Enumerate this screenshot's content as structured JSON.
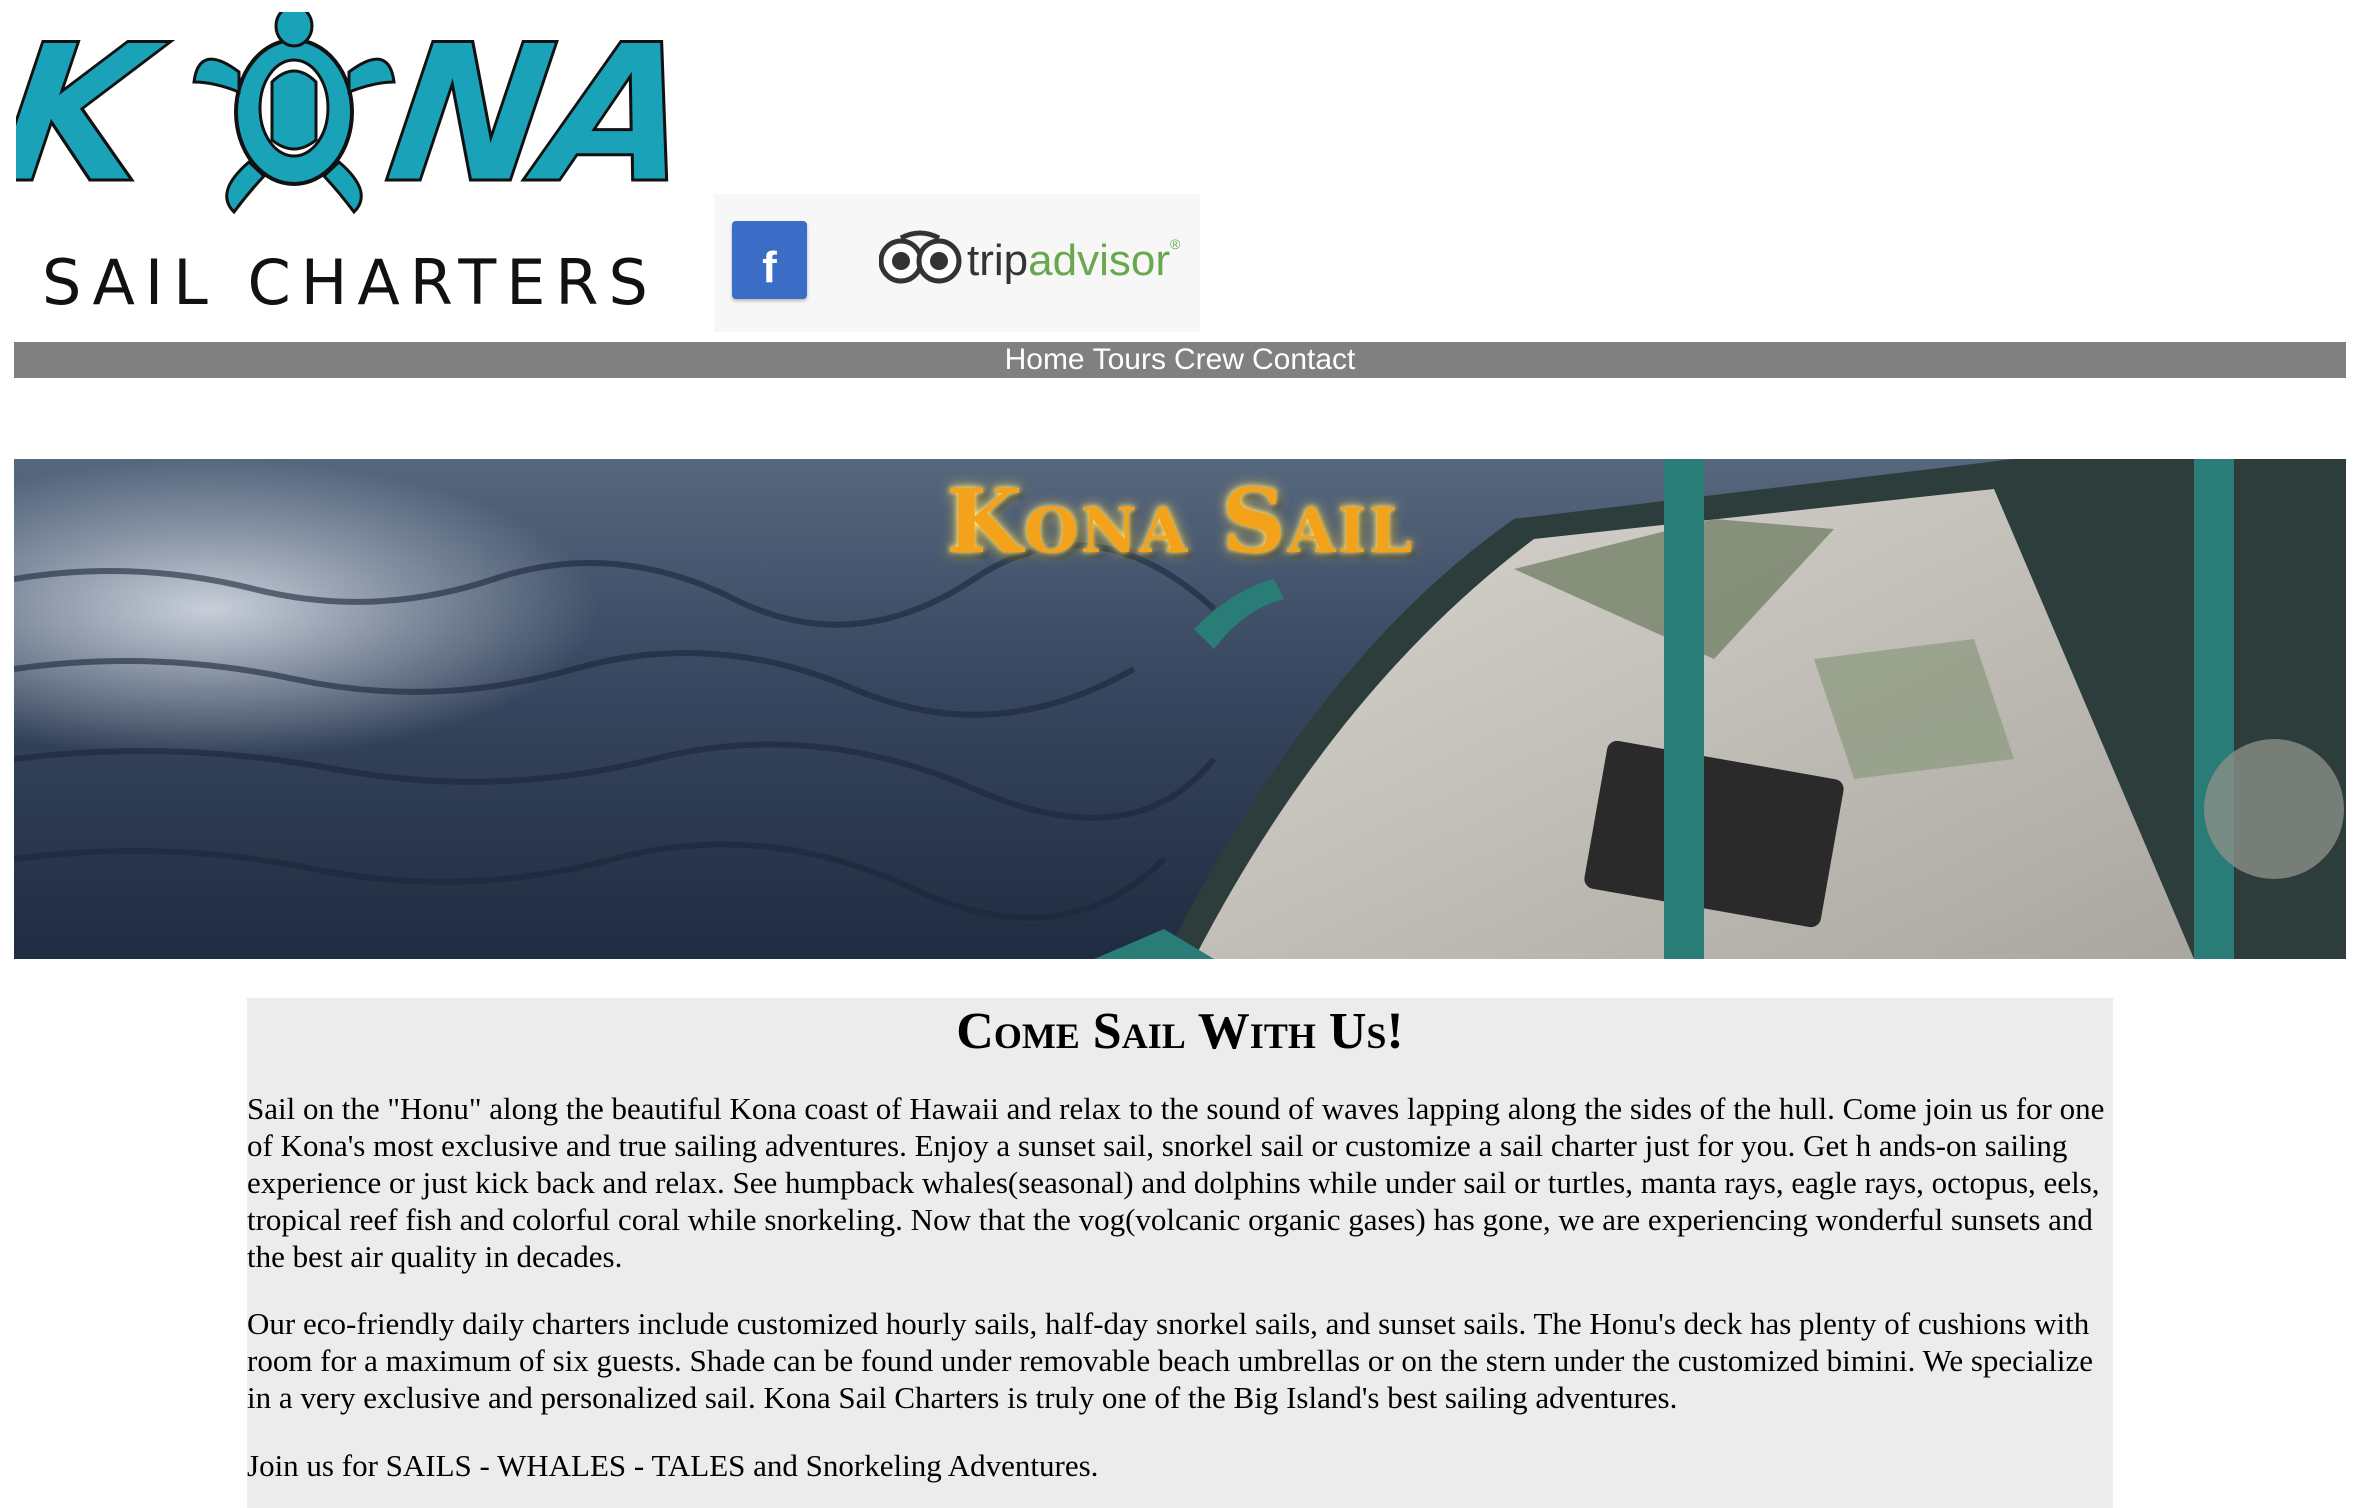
{
  "logo": {
    "wordmark": "KONA",
    "tagline": "SAIL CHARTERS"
  },
  "social": {
    "facebook_glyph": "f",
    "tripadvisor_text": "tripadvisor"
  },
  "nav": {
    "items": [
      "Home",
      "Tours",
      "Crew",
      "Contact"
    ]
  },
  "banner": {
    "title": "Kona Sail"
  },
  "main": {
    "heading": "Come Sail With Us!",
    "paragraphs": [
      "Sail on the \"Honu\" along the beautiful Kona coast of Hawaii and relax to the sound of waves lapping along the sides of the hull. Come join us for one of Kona's most exclusive and true sailing adventures. Enjoy a sunset sail, snorkel sail or customize a sail charter just for you. Get h ands-on sailing experience or just kick back and relax. See humpback whales(seasonal) and dolphins while under sail or turtles, manta rays, eagle rays, octopus, eels, tropical reef fish and colorful coral while snorkeling. Now that the vog(volcanic organic gases) has gone, we are experiencing wonderful sunsets and the best air quality in decades.",
      "Our eco-friendly daily charters include customized hourly sails, half-day snorkel sails, and sunset sails. The Honu's deck has plenty of cushions with room for a maximum of six guests. Shade can be found under removable beach umbrellas or on the stern under the customized bimini. We specialize in a very exclusive and personalized sail. Kona Sail Charters is truly one of the Big Island's best sailing adventures.",
      "Join us for SAILS - WHALES - TALES and Snorkeling Adventures."
    ]
  },
  "colors": {
    "logo_teal": "#1aa3b8",
    "nav_bg": "#808080",
    "content_bg": "#ececec",
    "title_gold": "#f5a21b",
    "facebook_blue": "#3b6cc6"
  }
}
